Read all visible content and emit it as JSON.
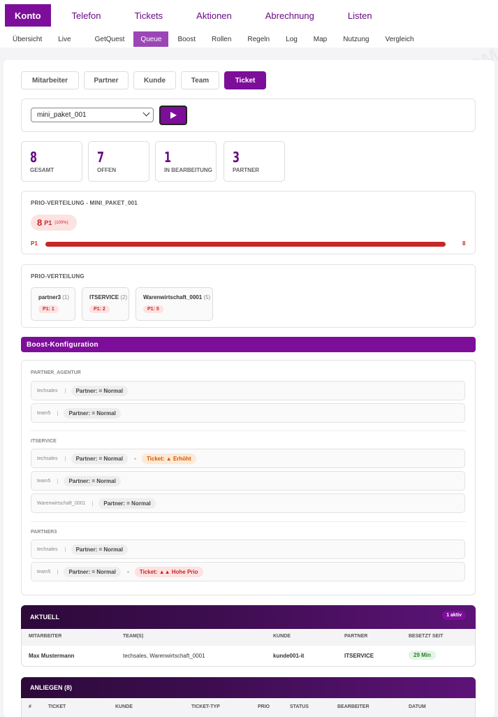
{
  "topnav": [
    "Konto",
    "Telefon",
    "Tickets",
    "Aktionen",
    "Abrechnung",
    "Listen"
  ],
  "subnav": [
    "Übersicht",
    "Live",
    "GetQuest",
    "Queue",
    "Boost",
    "Rollen",
    "Regeln",
    "Log",
    "Map",
    "Nutzung",
    "Vergleich"
  ],
  "tabs": [
    "Mitarbeiter",
    "Partner",
    "Kunde",
    "Team",
    "Ticket"
  ],
  "select": {
    "value": "mini_paket_001"
  },
  "play_icon": "play-icon",
  "stats": [
    {
      "value": "8",
      "label": "GESAMT"
    },
    {
      "value": "7",
      "label": "OFFEN"
    },
    {
      "value": "1",
      "label": "IN BEARBEITUNG"
    },
    {
      "value": "3",
      "label": "PARTNER"
    }
  ],
  "prio_dist": {
    "title": "PRIO-VERTEILUNG - MINI_PAKET_001",
    "count": "8",
    "prio": "P1",
    "percent": "(100%)",
    "bar_label": "P1",
    "bar_value": "8",
    "bar_fraction": 1.0
  },
  "prio_partner": {
    "title": "PRIO-VERTEILUNG",
    "items": [
      {
        "name": "partner3",
        "count": "(1)",
        "badge": "P1: 1"
      },
      {
        "name": "ITSERVICE",
        "count": "(2)",
        "badge": "P1: 2"
      },
      {
        "name": "Warenwirtschaft_0001",
        "count": "(5)",
        "badge": "P1: 5"
      }
    ]
  },
  "boost": {
    "title": "Boost-Konfiguration",
    "groups": [
      {
        "name": "PARTNER_AGENTUR",
        "rows": [
          {
            "who": "techsales",
            "partner": "Partner: = Normal",
            "ticket": ""
          },
          {
            "who": "team5",
            "partner": "Partner: = Normal",
            "ticket": ""
          }
        ]
      },
      {
        "name": "ITSERVICE",
        "rows": [
          {
            "who": "techsales",
            "partner": "Partner: = Normal",
            "ticket": "Ticket: ▲ Erhöht"
          },
          {
            "who": "team5",
            "partner": "Partner: = Normal",
            "ticket": ""
          },
          {
            "who": "Warenwirtschaft_0001",
            "partner": "Partner: = Normal",
            "ticket": ""
          }
        ]
      },
      {
        "name": "PARTNER3",
        "rows": [
          {
            "who": "techsales",
            "partner": "Partner: = Normal",
            "ticket": ""
          },
          {
            "who": "team5",
            "partner": "Partner: = Normal",
            "ticket": "Ticket: ▲▲ Hohe Prio"
          }
        ]
      }
    ]
  },
  "aktuell": {
    "title": "AKTUELL",
    "badge": "1 aktiv",
    "headers": [
      "MITARBEITER",
      "TEAM(S)",
      "KUNDE",
      "PARTNER",
      "BESETZT SEIT"
    ],
    "row": [
      "Max Mustermann",
      "techsales, Warenwirtschaft_0001",
      "kunde001-it",
      "ITSERVICE",
      "29 Min"
    ]
  },
  "anliegen": {
    "title": "ANLIEGEN (8)",
    "headers": [
      "#",
      "TICKET",
      "KUNDE",
      "TICKET-TYP",
      "PRIO",
      "STATUS",
      "BEARBEITER",
      "DATUM"
    ]
  },
  "watermark": "WWW.AUTOMACALL.COM",
  "colors": {
    "primary": "#7d0e9a",
    "danger": "#c62828",
    "dark": "#2d0a3a",
    "success": "#2e7d32"
  }
}
